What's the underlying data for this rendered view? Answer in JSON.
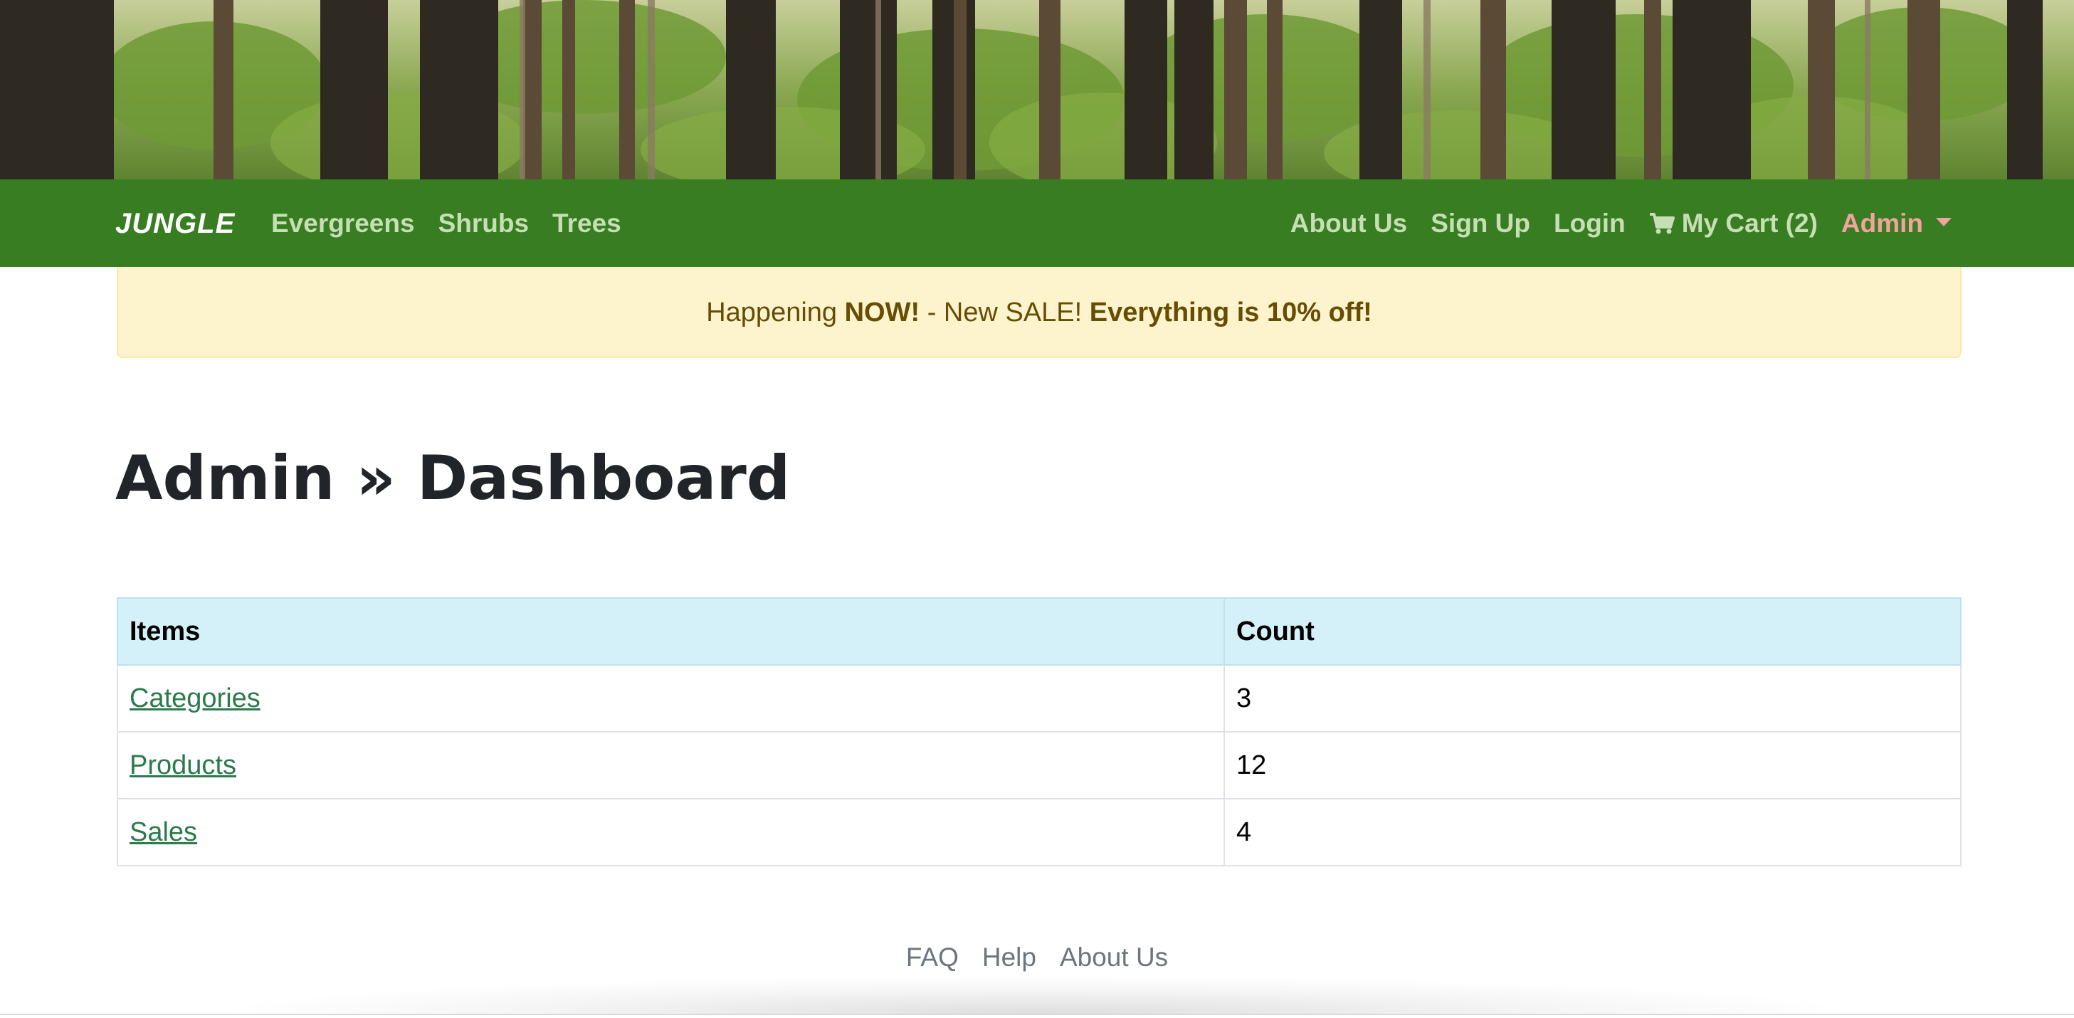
{
  "banner": {
    "image": "forest-trees-photo"
  },
  "navbar": {
    "brand": "JUNGLE",
    "left_links": [
      "Evergreens",
      "Shrubs",
      "Trees"
    ],
    "right": {
      "about": "About Us",
      "signup": "Sign Up",
      "login": "Login",
      "cart_label": "My Cart (2)",
      "cart_icon": "shopping-cart-icon",
      "admin": "Admin"
    },
    "colors": {
      "background": "#387d21",
      "link": "#c6dfb4",
      "admin": "#f2a39e"
    }
  },
  "alert": {
    "prefix": "Happening ",
    "now": "NOW!",
    "middle": " - New SALE! ",
    "offer": "Everything is 10% off!",
    "background": "#fdf3cd"
  },
  "page": {
    "title": "Admin » Dashboard"
  },
  "table": {
    "headers": [
      "Items",
      "Count"
    ],
    "rows": [
      {
        "item": "Categories",
        "count": "3"
      },
      {
        "item": "Products",
        "count": "12"
      },
      {
        "item": "Sales",
        "count": "4"
      }
    ],
    "header_background": "#d4f0f9",
    "link_color": "#2b7a4b"
  },
  "footer": {
    "links": [
      "FAQ",
      "Help",
      "About Us"
    ]
  }
}
